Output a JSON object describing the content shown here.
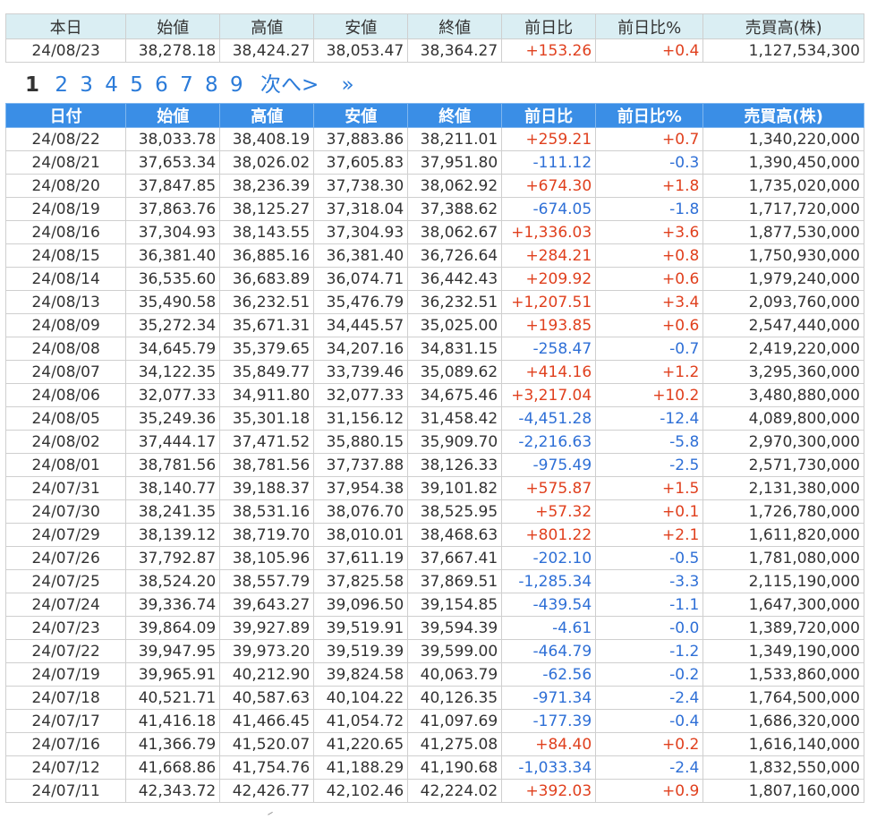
{
  "today": {
    "headers": [
      "本日",
      "始値",
      "高値",
      "安値",
      "終値",
      "前日比",
      "前日比%",
      "売買高(株)"
    ],
    "row": {
      "date": "24/08/23",
      "open": "38,278.18",
      "high": "38,424.27",
      "low": "38,053.47",
      "close": "38,364.27",
      "change": "+153.26",
      "change_pct": "+0.4",
      "volume": "1,127,534,300",
      "dir": "up"
    }
  },
  "pagination": {
    "current": "1",
    "pages": [
      "2",
      "3",
      "4",
      "5",
      "6",
      "7",
      "8",
      "9"
    ],
    "next_label": "次へ>",
    "last_label": "»"
  },
  "history": {
    "headers": [
      "日付",
      "始値",
      "高値",
      "安値",
      "終値",
      "前日比",
      "前日比%",
      "売買高(株)"
    ],
    "rows": [
      {
        "date": "24/08/22",
        "open": "38,033.78",
        "high": "38,408.19",
        "low": "37,883.86",
        "close": "38,211.01",
        "change": "+259.21",
        "change_pct": "+0.7",
        "volume": "1,340,220,000",
        "dir": "up"
      },
      {
        "date": "24/08/21",
        "open": "37,653.34",
        "high": "38,026.02",
        "low": "37,605.83",
        "close": "37,951.80",
        "change": "-111.12",
        "change_pct": "-0.3",
        "volume": "1,390,450,000",
        "dir": "down"
      },
      {
        "date": "24/08/20",
        "open": "37,847.85",
        "high": "38,236.39",
        "low": "37,738.30",
        "close": "38,062.92",
        "change": "+674.30",
        "change_pct": "+1.8",
        "volume": "1,735,020,000",
        "dir": "up"
      },
      {
        "date": "24/08/19",
        "open": "37,863.76",
        "high": "38,125.27",
        "low": "37,318.04",
        "close": "37,388.62",
        "change": "-674.05",
        "change_pct": "-1.8",
        "volume": "1,717,720,000",
        "dir": "down"
      },
      {
        "date": "24/08/16",
        "open": "37,304.93",
        "high": "38,143.55",
        "low": "37,304.93",
        "close": "38,062.67",
        "change": "+1,336.03",
        "change_pct": "+3.6",
        "volume": "1,877,530,000",
        "dir": "up"
      },
      {
        "date": "24/08/15",
        "open": "36,381.40",
        "high": "36,885.16",
        "low": "36,381.40",
        "close": "36,726.64",
        "change": "+284.21",
        "change_pct": "+0.8",
        "volume": "1,750,930,000",
        "dir": "up"
      },
      {
        "date": "24/08/14",
        "open": "36,535.60",
        "high": "36,683.89",
        "low": "36,074.71",
        "close": "36,442.43",
        "change": "+209.92",
        "change_pct": "+0.6",
        "volume": "1,979,240,000",
        "dir": "up"
      },
      {
        "date": "24/08/13",
        "open": "35,490.58",
        "high": "36,232.51",
        "low": "35,476.79",
        "close": "36,232.51",
        "change": "+1,207.51",
        "change_pct": "+3.4",
        "volume": "2,093,760,000",
        "dir": "up"
      },
      {
        "date": "24/08/09",
        "open": "35,272.34",
        "high": "35,671.31",
        "low": "34,445.57",
        "close": "35,025.00",
        "change": "+193.85",
        "change_pct": "+0.6",
        "volume": "2,547,440,000",
        "dir": "up"
      },
      {
        "date": "24/08/08",
        "open": "34,645.79",
        "high": "35,379.65",
        "low": "34,207.16",
        "close": "34,831.15",
        "change": "-258.47",
        "change_pct": "-0.7",
        "volume": "2,419,220,000",
        "dir": "down"
      },
      {
        "date": "24/08/07",
        "open": "34,122.35",
        "high": "35,849.77",
        "low": "33,739.46",
        "close": "35,089.62",
        "change": "+414.16",
        "change_pct": "+1.2",
        "volume": "3,295,360,000",
        "dir": "up"
      },
      {
        "date": "24/08/06",
        "open": "32,077.33",
        "high": "34,911.80",
        "low": "32,077.33",
        "close": "34,675.46",
        "change": "+3,217.04",
        "change_pct": "+10.2",
        "volume": "3,480,880,000",
        "dir": "up"
      },
      {
        "date": "24/08/05",
        "open": "35,249.36",
        "high": "35,301.18",
        "low": "31,156.12",
        "close": "31,458.42",
        "change": "-4,451.28",
        "change_pct": "-12.4",
        "volume": "4,089,800,000",
        "dir": "down"
      },
      {
        "date": "24/08/02",
        "open": "37,444.17",
        "high": "37,471.52",
        "low": "35,880.15",
        "close": "35,909.70",
        "change": "-2,216.63",
        "change_pct": "-5.8",
        "volume": "2,970,300,000",
        "dir": "down"
      },
      {
        "date": "24/08/01",
        "open": "38,781.56",
        "high": "38,781.56",
        "low": "37,737.88",
        "close": "38,126.33",
        "change": "-975.49",
        "change_pct": "-2.5",
        "volume": "2,571,730,000",
        "dir": "down"
      },
      {
        "date": "24/07/31",
        "open": "38,140.77",
        "high": "39,188.37",
        "low": "37,954.38",
        "close": "39,101.82",
        "change": "+575.87",
        "change_pct": "+1.5",
        "volume": "2,131,380,000",
        "dir": "up"
      },
      {
        "date": "24/07/30",
        "open": "38,241.35",
        "high": "38,531.16",
        "low": "38,076.70",
        "close": "38,525.95",
        "change": "+57.32",
        "change_pct": "+0.1",
        "volume": "1,726,780,000",
        "dir": "up"
      },
      {
        "date": "24/07/29",
        "open": "38,139.12",
        "high": "38,719.70",
        "low": "38,010.01",
        "close": "38,468.63",
        "change": "+801.22",
        "change_pct": "+2.1",
        "volume": "1,611,820,000",
        "dir": "up"
      },
      {
        "date": "24/07/26",
        "open": "37,792.87",
        "high": "38,105.96",
        "low": "37,611.19",
        "close": "37,667.41",
        "change": "-202.10",
        "change_pct": "-0.5",
        "volume": "1,781,080,000",
        "dir": "down"
      },
      {
        "date": "24/07/25",
        "open": "38,524.20",
        "high": "38,557.79",
        "low": "37,825.58",
        "close": "37,869.51",
        "change": "-1,285.34",
        "change_pct": "-3.3",
        "volume": "2,115,190,000",
        "dir": "down"
      },
      {
        "date": "24/07/24",
        "open": "39,336.74",
        "high": "39,643.27",
        "low": "39,096.50",
        "close": "39,154.85",
        "change": "-439.54",
        "change_pct": "-1.1",
        "volume": "1,647,300,000",
        "dir": "down"
      },
      {
        "date": "24/07/23",
        "open": "39,864.09",
        "high": "39,927.89",
        "low": "39,519.91",
        "close": "39,594.39",
        "change": "-4.61",
        "change_pct": "-0.0",
        "volume": "1,389,720,000",
        "dir": "down"
      },
      {
        "date": "24/07/22",
        "open": "39,947.95",
        "high": "39,973.20",
        "low": "39,519.39",
        "close": "39,599.00",
        "change": "-464.79",
        "change_pct": "-1.2",
        "volume": "1,349,190,000",
        "dir": "down"
      },
      {
        "date": "24/07/19",
        "open": "39,965.91",
        "high": "40,212.90",
        "low": "39,824.58",
        "close": "40,063.79",
        "change": "-62.56",
        "change_pct": "-0.2",
        "volume": "1,533,860,000",
        "dir": "down"
      },
      {
        "date": "24/07/18",
        "open": "40,521.71",
        "high": "40,587.63",
        "low": "40,104.22",
        "close": "40,126.35",
        "change": "-971.34",
        "change_pct": "-2.4",
        "volume": "1,764,500,000",
        "dir": "down"
      },
      {
        "date": "24/07/17",
        "open": "41,416.18",
        "high": "41,466.45",
        "low": "41,054.72",
        "close": "41,097.69",
        "change": "-177.39",
        "change_pct": "-0.4",
        "volume": "1,686,320,000",
        "dir": "down"
      },
      {
        "date": "24/07/16",
        "open": "41,366.79",
        "high": "41,520.07",
        "low": "41,220.65",
        "close": "41,275.08",
        "change": "+84.40",
        "change_pct": "+0.2",
        "volume": "1,616,140,000",
        "dir": "up"
      },
      {
        "date": "24/07/12",
        "open": "41,668.86",
        "high": "41,754.76",
        "low": "41,188.29",
        "close": "41,190.68",
        "change": "-1,033.34",
        "change_pct": "-2.4",
        "volume": "1,832,550,000",
        "dir": "down"
      },
      {
        "date": "24/07/11",
        "open": "42,343.72",
        "high": "42,426.77",
        "low": "42,102.46",
        "close": "42,224.02",
        "change": "+392.03",
        "change_pct": "+0.9",
        "volume": "1,807,160,000",
        "dir": "up"
      }
    ]
  },
  "colors": {
    "up": "#e0401e",
    "down": "#2e6fd6",
    "header_blue": "#3a8ee6",
    "header_light": "#daeef3",
    "link": "#2b7bd9"
  }
}
